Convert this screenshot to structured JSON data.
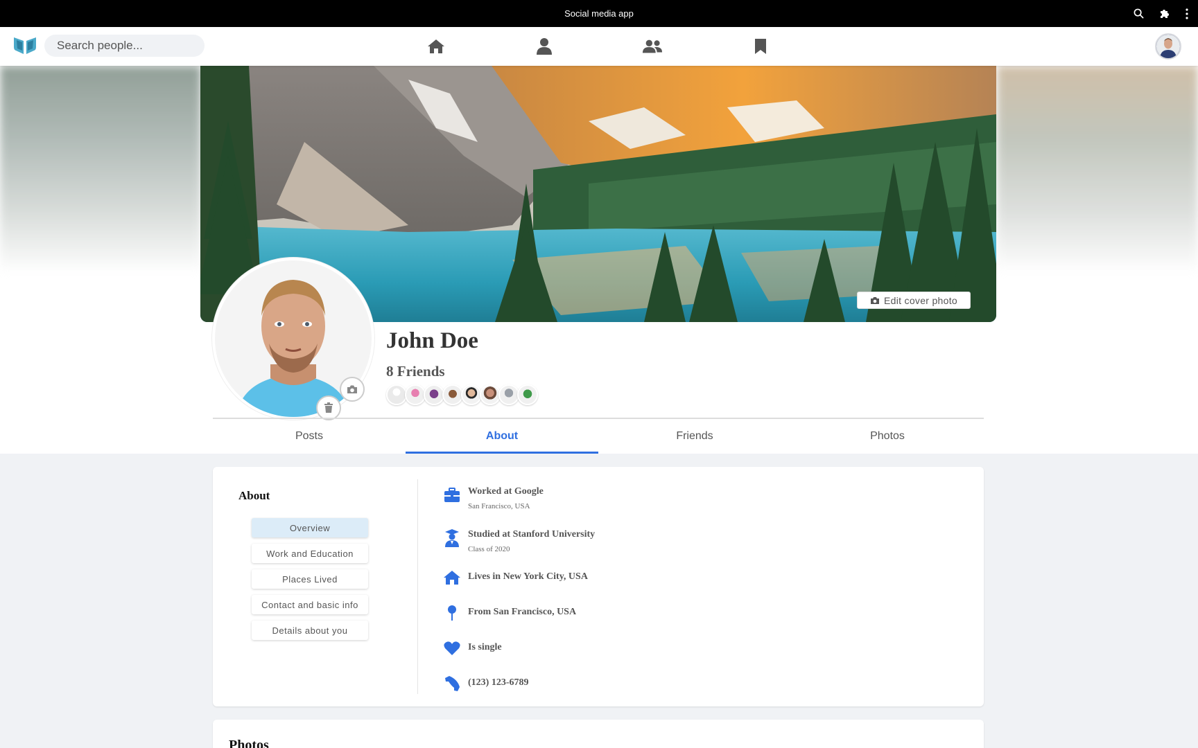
{
  "window": {
    "title": "Social media app"
  },
  "nav": {
    "search_placeholder": "Search people...",
    "icons": [
      "home-icon",
      "profile-icon",
      "friends-icon",
      "bookmark-icon"
    ]
  },
  "cover": {
    "edit_label": "Edit cover photo"
  },
  "profile": {
    "name": "John Doe",
    "friends_label": "8 Friends",
    "friend_count": 8
  },
  "tabs": [
    {
      "label": "Posts",
      "active": false
    },
    {
      "label": "About",
      "active": true
    },
    {
      "label": "Friends",
      "active": false
    },
    {
      "label": "Photos",
      "active": false
    }
  ],
  "about": {
    "title": "About",
    "nav": [
      "Overview",
      "Work and Education",
      "Places Lived",
      "Contact and basic info",
      "Details about you"
    ],
    "selected": "Overview",
    "details": [
      {
        "icon": "briefcase-icon",
        "title": "Worked at Google",
        "subtitle": "San Francisco, USA"
      },
      {
        "icon": "graduate-icon",
        "title": "Studied at Stanford University",
        "subtitle": "Class of 2020"
      },
      {
        "icon": "home-icon",
        "title": "Lives in New York City, USA",
        "subtitle": ""
      },
      {
        "icon": "map-pin-icon",
        "title": "From San Francisco, USA",
        "subtitle": ""
      },
      {
        "icon": "heart-icon",
        "title": "Is single",
        "subtitle": ""
      },
      {
        "icon": "phone-icon",
        "title": "(123) 123-6789",
        "subtitle": ""
      }
    ]
  },
  "photos": {
    "title": "Photos"
  },
  "colors": {
    "accent": "#2f6fe0",
    "icon_blue": "#2f6fe0",
    "nav_icon": "#555555"
  }
}
